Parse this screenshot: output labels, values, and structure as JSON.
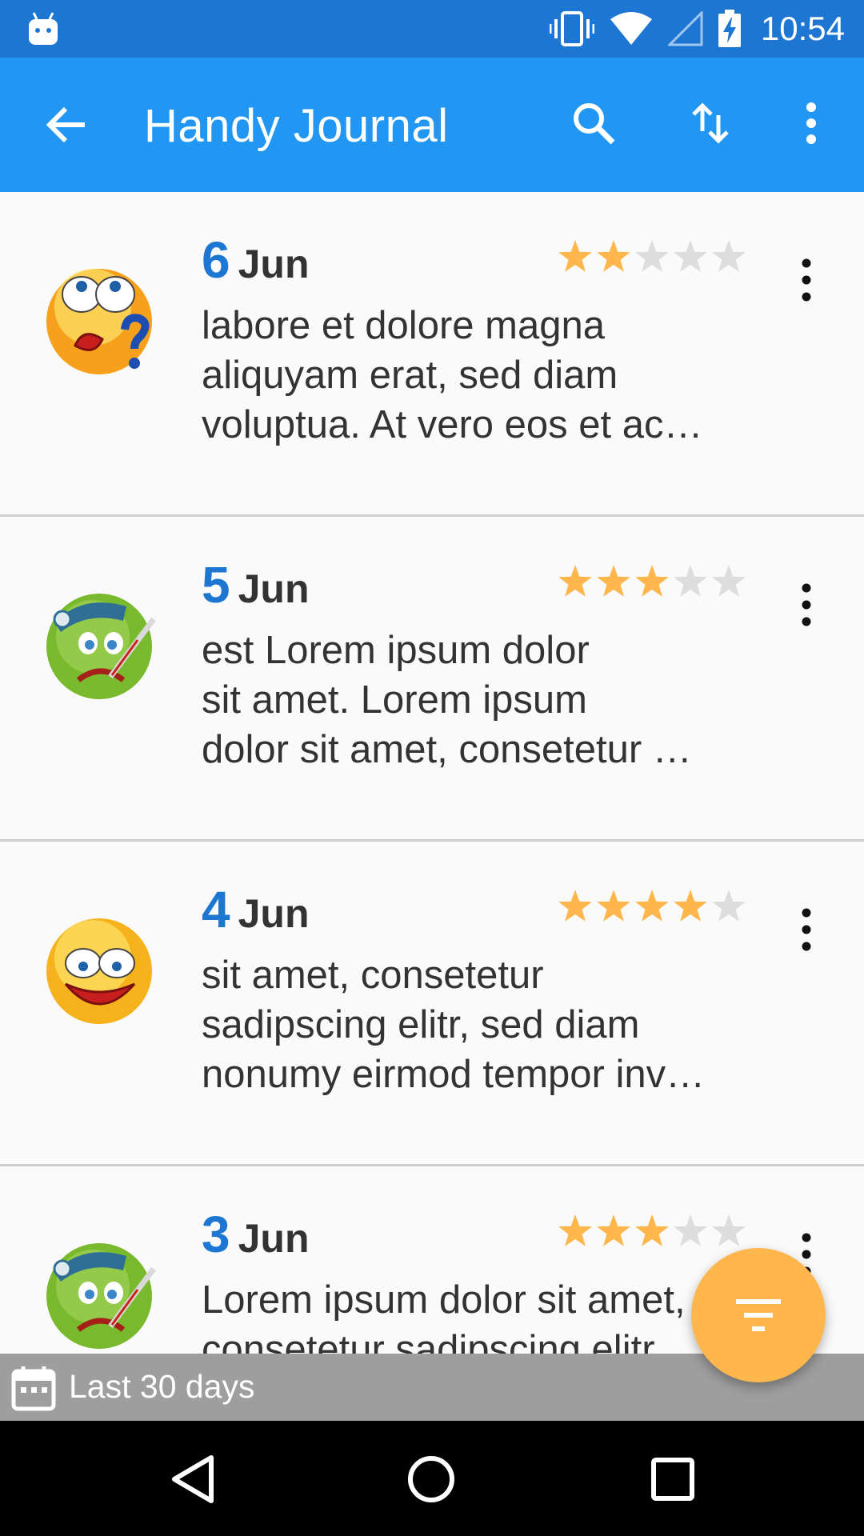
{
  "status_bar": {
    "time": "10:54",
    "icons": [
      "android-debug-icon",
      "vibrate-icon",
      "wifi-icon",
      "signal-icon",
      "battery-charging-icon"
    ]
  },
  "app_bar": {
    "title": "Handy Journal",
    "back_icon": "arrow-left-icon",
    "actions": [
      "search-icon",
      "sort-icon",
      "more-vert-icon"
    ]
  },
  "entries": [
    {
      "day": "6",
      "month": "Jun",
      "rating": 2,
      "max_rating": 5,
      "mood_icon": "confused-face-icon",
      "text_lines": [
        "labore et dolore magna",
        "aliquyam erat, sed diam",
        "voluptua. At vero eos et ac…"
      ]
    },
    {
      "day": "5",
      "month": "Jun",
      "rating": 3,
      "max_rating": 5,
      "mood_icon": "sick-face-icon",
      "text_lines": [
        "est Lorem ipsum dolor",
        "sit amet. Lorem ipsum",
        "dolor sit amet, consetetur …"
      ]
    },
    {
      "day": "4",
      "month": "Jun",
      "rating": 4,
      "max_rating": 5,
      "mood_icon": "happy-face-icon",
      "text_lines": [
        "sit amet, consetetur",
        "sadipscing elitr, sed diam",
        "nonumy eirmod tempor inv…"
      ]
    },
    {
      "day": "3",
      "month": "Jun",
      "rating": 3,
      "max_rating": 5,
      "mood_icon": "sick-face-icon",
      "text_lines": [
        "Lorem ipsum dolor sit amet,",
        "consetetur sadipscing elitr,",
        ""
      ]
    }
  ],
  "filter_bar": {
    "label": "Last 30 days",
    "icon": "calendar-icon"
  },
  "fab": {
    "icon": "filter-icon"
  },
  "colors": {
    "status_bar": "#1c76d2",
    "app_bar": "#2196f3",
    "day_number": "#1c76d2",
    "star_filled": "#ffb74d",
    "star_empty": "#dddddd",
    "fab": "#ffb74d",
    "filter_bar": "#9e9e9e"
  },
  "nav_bar": [
    "nav-back-icon",
    "nav-home-icon",
    "nav-recents-icon"
  ]
}
